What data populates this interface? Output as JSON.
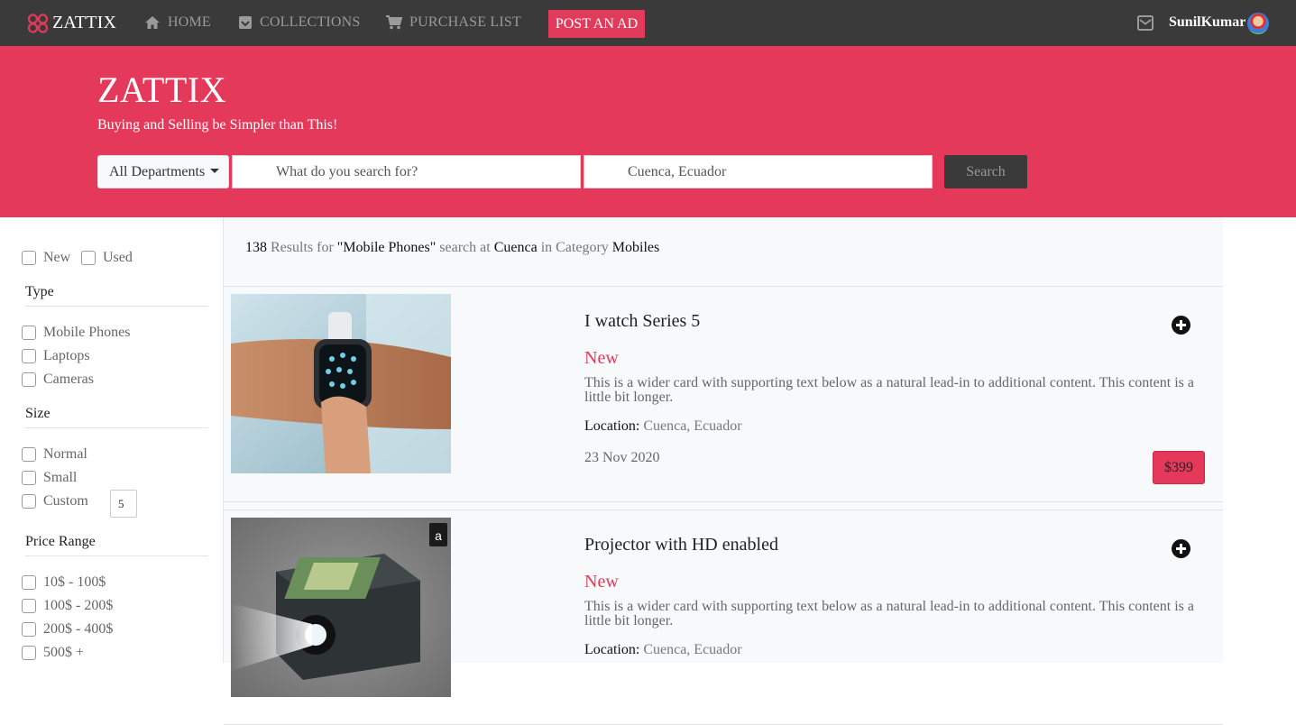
{
  "nav": {
    "brand": "ZATTIX",
    "items": [
      {
        "label": "HOME",
        "icon": "home-icon"
      },
      {
        "label": "COLLECTIONS",
        "icon": "inbox-icon"
      },
      {
        "label": "PURCHASE LIST",
        "icon": "cart-icon"
      }
    ],
    "post_ad": "POST AN AD",
    "username": "SunilKumar"
  },
  "hero": {
    "title": "ZATTIX",
    "subtitle": "Buying and Selling be Simpler than This!",
    "department": "All Departments",
    "search_placeholder": "What do you search for?",
    "location_value": "Cuenca, Ecuador",
    "search_button": "Search"
  },
  "filters": {
    "condition": [
      "New",
      "Used"
    ],
    "type_title": "Type",
    "types": [
      "Mobile Phones",
      "Laptops",
      "Cameras"
    ],
    "size_title": "Size",
    "sizes": [
      "Normal",
      "Small",
      "Custom"
    ],
    "custom_value": "5",
    "price_title": "Price Range",
    "prices": [
      "10$ - 100$",
      "100$ - 200$",
      "200$ - 400$",
      "500$ +"
    ]
  },
  "results": {
    "count": "138",
    "text1": "Results for",
    "query": "\"Mobile Phones\"",
    "text2": "search at",
    "city": "Cuenca",
    "text3": "in Category",
    "category": "Mobiles"
  },
  "listings": [
    {
      "title": "I watch Series 5",
      "condition": "New",
      "description": "This is a wider card with supporting text below as a natural lead-in to additional content. This content is a little bit longer.",
      "location_label": "Location:",
      "location": "Cuenca, Ecuador",
      "date": "23 Nov 2020",
      "price": "$399"
    },
    {
      "title": "Projector with HD enabled",
      "condition": "New",
      "description": "This is a wider card with supporting text below as a natural lead-in to additional content. This content is a little bit longer.",
      "location_label": "Location:",
      "location": "Cuenca, Ecuador"
    }
  ],
  "colors": {
    "accent": "#e5395b",
    "navbar": "#3a3a3a"
  }
}
